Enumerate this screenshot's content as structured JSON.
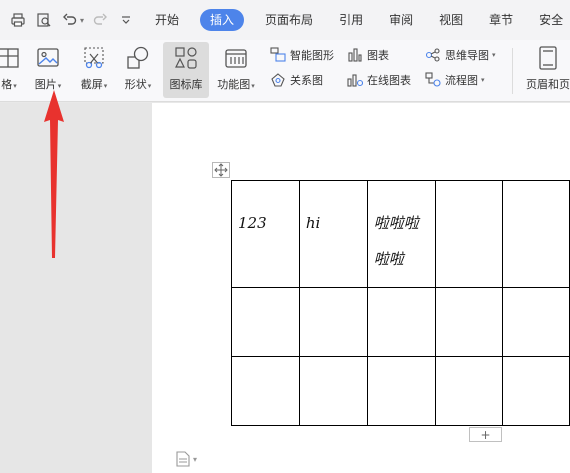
{
  "menubar": {
    "tabs": [
      {
        "label": "开始",
        "active": false
      },
      {
        "label": "插入",
        "active": true
      },
      {
        "label": "页面布局",
        "active": false
      },
      {
        "label": "引用",
        "active": false
      },
      {
        "label": "审阅",
        "active": false
      },
      {
        "label": "视图",
        "active": false
      },
      {
        "label": "章节",
        "active": false
      },
      {
        "label": "安全",
        "active": false
      }
    ],
    "active_color": "#4d84ea"
  },
  "ribbon": {
    "table_label": "格",
    "picture_label": "图片",
    "screenshot_label": "截屏",
    "shapes_label": "形状",
    "icon_library_label": "图标库",
    "function_chart_label": "功能图",
    "smart_graphic_label": "智能图形",
    "relation_chart_label": "关系图",
    "chart_label": "图表",
    "online_chart_label": "在线图表",
    "mind_map_label": "思维导图",
    "flowchart_label": "流程图",
    "header_footer_label": "页眉和页"
  },
  "table": {
    "rows": [
      [
        "123",
        "hi",
        "啦啦啦啦啦",
        "",
        ""
      ],
      [
        "",
        "",
        "",
        "",
        ""
      ],
      [
        "",
        "",
        "",
        "",
        ""
      ]
    ]
  },
  "add_row_label": "+",
  "annotation_color": "#e8322e"
}
